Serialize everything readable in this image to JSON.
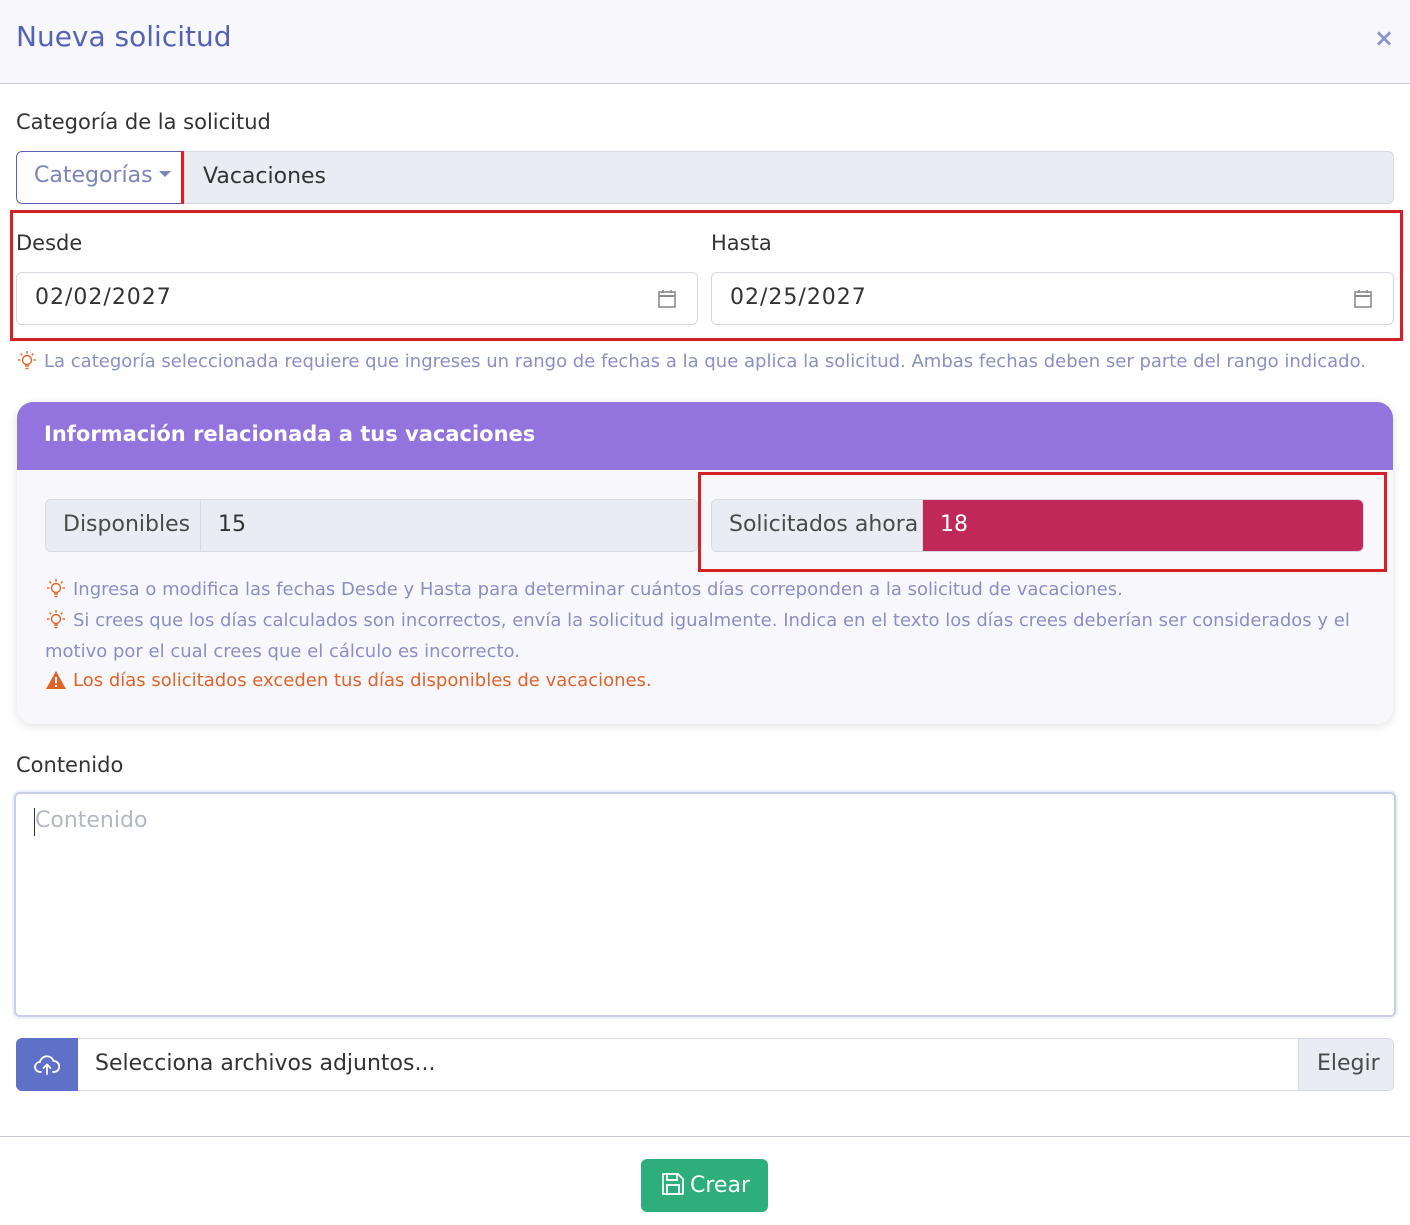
{
  "modal": {
    "title": "Nueva solicitud",
    "close_label": "×"
  },
  "category": {
    "label": "Categoría de la solicitud",
    "dropdown_label": "Categorías",
    "selected_value": "Vacaciones"
  },
  "dates": {
    "from_label": "Desde",
    "from_value": "02/02/2027",
    "to_label": "Hasta",
    "to_value": "02/25/2027",
    "hint": "La categoría seleccionada requiere que ingreses un rango de fechas a la que aplica la solicitud. Ambas fechas deben ser parte del rango indicado."
  },
  "vacation_card": {
    "title": "Información relacionada a tus vacaciones",
    "available_label": "Disponibles",
    "available_value": "15",
    "requested_label": "Solicitados ahora",
    "requested_value": "18",
    "hints": [
      "Ingresa o modifica las fechas Desde y Hasta para determinar cuántos días correponden a la solicitud de vacaciones.",
      "Si crees que los días calculados son incorrectos, envía la solicitud igualmente. Indica en el texto los días crees deberían ser considerados y el motivo por el cual crees que el cálculo es incorrecto."
    ],
    "warning": "Los días solicitados exceden tus días disponibles de vacaciones."
  },
  "content": {
    "label": "Contenido",
    "placeholder": "Contenido",
    "value": ""
  },
  "attachments": {
    "placeholder": "Selecciona archivos adjuntos...",
    "button_label": "Elegir"
  },
  "footer": {
    "create_label": "Crear"
  },
  "colors": {
    "primary": "#5562b5",
    "card_header": "#9374df",
    "danger": "#c0285a",
    "success": "#2eae7a",
    "warning": "#e0632a",
    "highlight": "#d42027"
  }
}
